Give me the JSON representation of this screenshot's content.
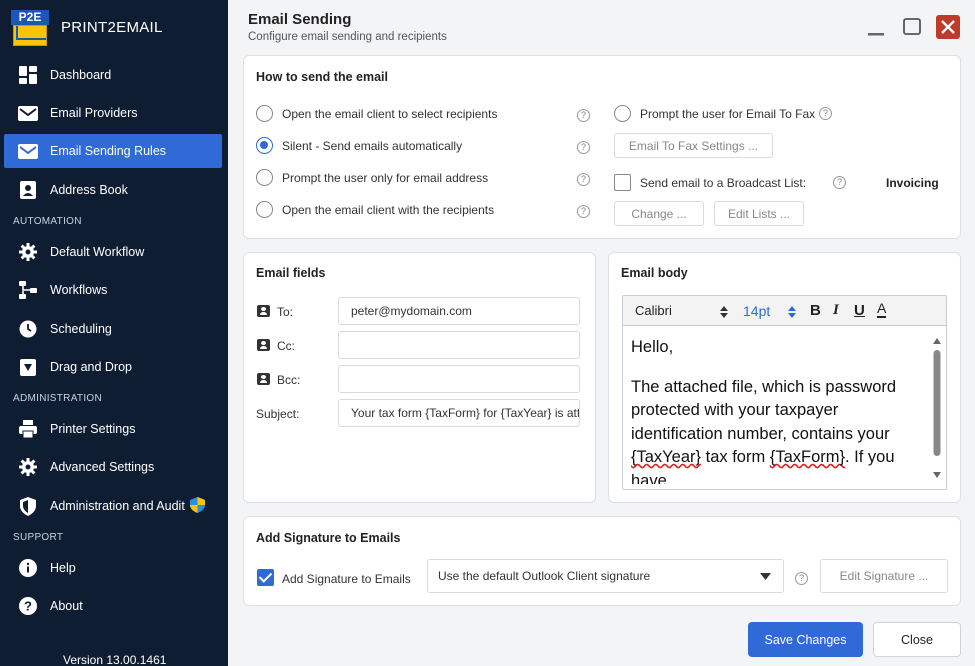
{
  "app": {
    "name": "PRINT2EMAIL",
    "logo_text": "P2E",
    "version": "Version 13.00.1461"
  },
  "sidebar": {
    "items": [
      {
        "label": "Dashboard",
        "icon": "dashboard-icon"
      },
      {
        "label": "Email Providers",
        "icon": "envelope-icon"
      },
      {
        "label": "Email Sending Rules",
        "icon": "envelope-icon",
        "active": true
      },
      {
        "label": "Address Book",
        "icon": "contact-card-icon"
      }
    ],
    "automation_label": "AUTOMATION",
    "automation": [
      {
        "label": "Default Workflow",
        "icon": "gear-icon"
      },
      {
        "label": "Workflows",
        "icon": "workflow-icon"
      },
      {
        "label": "Scheduling",
        "icon": "clock-icon"
      },
      {
        "label": "Drag and Drop",
        "icon": "drop-icon"
      }
    ],
    "administration_label": "ADMINISTRATION",
    "administration": [
      {
        "label": "Printer Settings",
        "icon": "printer-icon"
      },
      {
        "label": "Advanced Settings",
        "icon": "gear-icon"
      },
      {
        "label": "Administration and Audit",
        "icon": "shield-icon"
      }
    ],
    "support_label": "SUPPORT",
    "support": [
      {
        "label": "Help",
        "icon": "info-icon"
      },
      {
        "label": "About",
        "icon": "question-icon"
      }
    ]
  },
  "header": {
    "title": "Email Sending",
    "subtitle": "Configure email sending and recipients"
  },
  "how_to_send": {
    "title": "How to send the email",
    "options": [
      "Open the email client to select recipients",
      "Silent - Send emails automatically",
      "Prompt the user only for email address",
      "Open the email client with the recipients"
    ],
    "selected_index": 1,
    "fax_prompt": "Prompt the user for Email To Fax",
    "fax_settings_button": "Email To Fax Settings ...",
    "broadcast_label": "Send email to a Broadcast List:",
    "broadcast_list": "Invoicing",
    "change_button": "Change ...",
    "edit_lists_button": "Edit Lists ..."
  },
  "email_fields": {
    "title": "Email fields",
    "to_label": "To:",
    "to_value": "peter@mydomain.com",
    "cc_label": "Cc:",
    "cc_value": "",
    "bcc_label": "Bcc:",
    "bcc_value": "",
    "subject_label": "Subject:",
    "subject_value": "Your tax form {TaxForm} for {TaxYear} is atta"
  },
  "email_body": {
    "title": "Email body",
    "font": "Calibri",
    "size": "14pt",
    "bold": "B",
    "italic": "I",
    "underline": "U",
    "color": "A",
    "greeting": "Hello,",
    "p1": "The attached file, which is password protected with your taxpayer identification number, contains your ",
    "tok1": "{TaxYear}",
    "p2": " tax form ",
    "tok2": "{TaxForm}",
    "p3": ". If you have"
  },
  "signature": {
    "title": "Add Signature to Emails",
    "checkbox_label": "Add Signature to Emails",
    "selected": "Use the default Outlook Client signature",
    "edit_button": "Edit Signature ..."
  },
  "footer": {
    "save": "Save Changes",
    "close": "Close"
  },
  "colors": {
    "sidebar": "#0f1d33",
    "accent": "#2f6ad6",
    "close": "#c0392b"
  }
}
